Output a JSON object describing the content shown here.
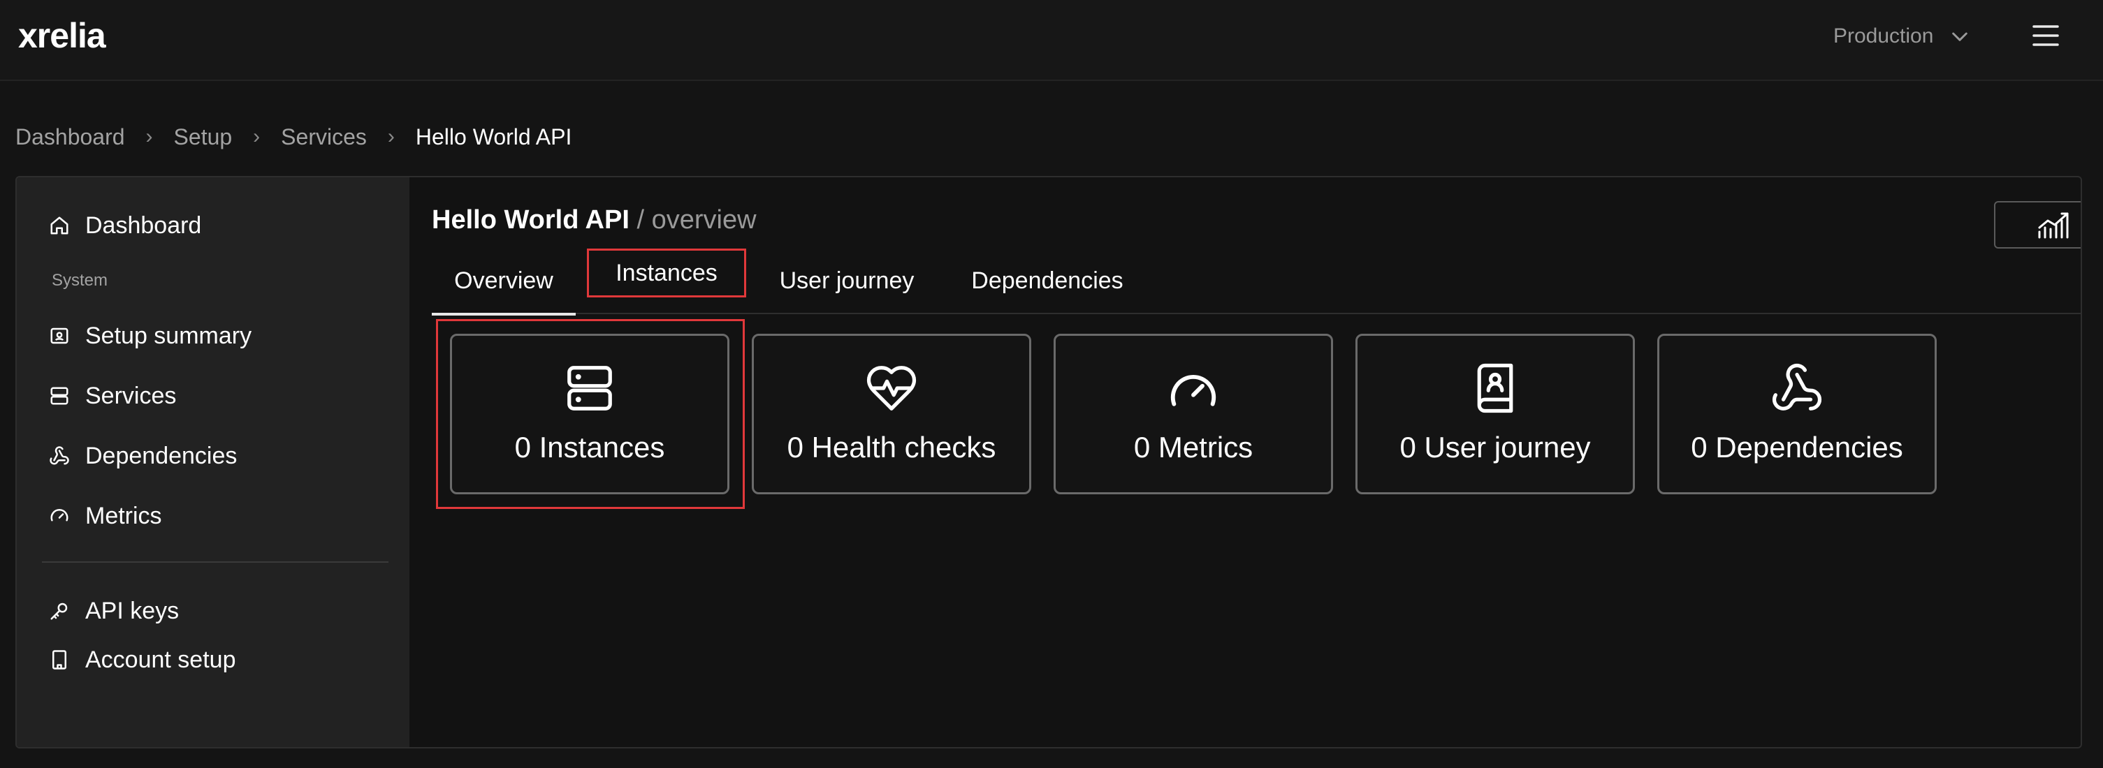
{
  "brand": {
    "logo_text": "xrelia"
  },
  "header": {
    "environment": "Production"
  },
  "breadcrumb": [
    "Dashboard",
    "Setup",
    "Services",
    "Hello World API"
  ],
  "sidebar": {
    "top_item": "Dashboard",
    "section_label": "System",
    "items": [
      "Setup summary",
      "Services",
      "Dependencies",
      "Metrics"
    ],
    "bottom_items": [
      "API keys",
      "Account setup"
    ]
  },
  "page": {
    "title": "Hello World API",
    "subtitle": " / overview"
  },
  "tabs": [
    "Overview",
    "Instances",
    "User journey",
    "Dependencies"
  ],
  "tiles": [
    {
      "label": "0 Instances",
      "icon": "server-icon"
    },
    {
      "label": "0 Health checks",
      "icon": "heart-pulse-icon"
    },
    {
      "label": "0 Metrics",
      "icon": "gauge-icon"
    },
    {
      "label": "0 User journey",
      "icon": "book-user-icon"
    },
    {
      "label": "0 Dependencies",
      "icon": "webhook-icon"
    }
  ],
  "colors": {
    "highlight": "#e0383a",
    "background": "#141414",
    "sidebar": "#222222"
  }
}
